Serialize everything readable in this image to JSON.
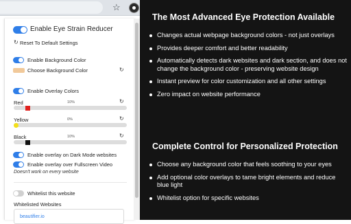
{
  "popup": {
    "main_toggle_label": "Enable Eye Strain Reducer",
    "reset_label": "Reset To Default Settings",
    "bg_toggle_label": "Enable Background Color",
    "choose_bg_label": "Choose Background Color",
    "bg_color": "#f1c99a",
    "overlay_toggle_label": "Enable Overlay Colors",
    "sliders": [
      {
        "label": "Red",
        "percent": "10%",
        "value": 0.1,
        "color": "#e0201c"
      },
      {
        "label": "Yellow",
        "percent": "0%",
        "value": 0.0,
        "color": "#f3df1a"
      },
      {
        "label": "Black",
        "percent": "10%",
        "value": 0.1,
        "color": "#111111"
      }
    ],
    "dark_mode_label": "Enable overlay on Dark Mode websites",
    "fullscreen_label": "Enable overlay over Fullscreen Video",
    "fullscreen_note": "Doesn't work on every website",
    "whitelist_toggle_label": "Whitelist this website",
    "whitelisted_heading": "Whitelisted Websites",
    "whitelist_input_value": "beautifier.io",
    "toggles": {
      "main": true,
      "background": true,
      "overlay": true,
      "dark_mode": true,
      "fullscreen": true,
      "whitelist": false
    }
  },
  "info": {
    "heading1": "The Most Advanced Eye Protection Available",
    "features": [
      "Changes actual webpage background colors - not just overlays",
      "Provides deeper comfort and better readability",
      "Automatically detects dark websites and dark section, and does not change the background color - preserving website design",
      "Instant preview for color customization and all other settings",
      "Zero impact on website performance"
    ],
    "heading2": "Complete Control for Personalized Protection",
    "controls": [
      "Choose any background color that feels soothing to your eyes",
      "Add optional color overlays to tame bright elements and reduce blue light",
      "Whitelist option for specific websites"
    ]
  },
  "icons": {
    "star": "star-icon",
    "extension": "extension-icon",
    "reset": "reset-icon"
  }
}
